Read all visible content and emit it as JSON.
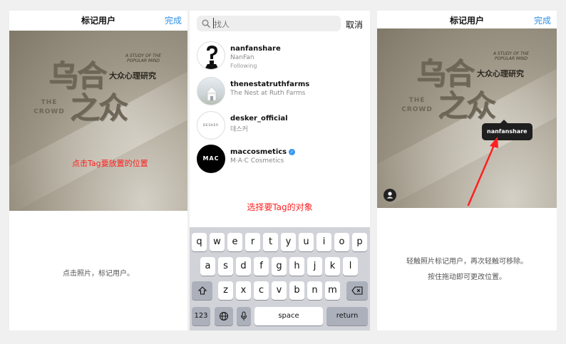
{
  "left": {
    "title": "标记用户",
    "done": "完成",
    "cover": {
      "big1": "乌合",
      "big2": "之众",
      "study": "A STUDY OF THE POPULAR MIND",
      "subtitle": "大众心理研究",
      "crowd": "THE CROWD"
    },
    "instruction": "点击Tag要放置的位置",
    "caption": "点击照片，标记用户。"
  },
  "middle": {
    "search_placeholder": "找人",
    "cancel": "取消",
    "users": [
      {
        "username": "nanfanshare",
        "name": "NanFan",
        "status": "Following"
      },
      {
        "username": "thenestatruthfarms",
        "name": "The Nest at Ruth Farms",
        "status": ""
      },
      {
        "username": "desker_official",
        "name": "데스커",
        "status": ""
      },
      {
        "username": "maccosmetics",
        "name": "M·A·C Cosmetics",
        "status": "",
        "verified": true
      }
    ],
    "avatar_labels": {
      "desker": "DESKER",
      "mac": "MAC"
    },
    "instruction": "选择要Tag的对象",
    "keyboard": {
      "row1": [
        "q",
        "w",
        "e",
        "r",
        "t",
        "y",
        "u",
        "i",
        "o",
        "p"
      ],
      "row2": [
        "a",
        "s",
        "d",
        "f",
        "g",
        "h",
        "j",
        "k",
        "l"
      ],
      "row3": [
        "z",
        "x",
        "c",
        "v",
        "b",
        "n",
        "m"
      ],
      "num": "123",
      "space": "space",
      "return": "return"
    }
  },
  "right": {
    "title": "标记用户",
    "done": "完成",
    "tag": "nanfanshare",
    "caption1": "轻触照片标记用户，再次轻触可移除。",
    "caption2": "按住拖动即可更改位置。"
  },
  "colors": {
    "accent": "#2f8fe6",
    "annotation": "#ff2020",
    "verified": "#3897f0"
  }
}
